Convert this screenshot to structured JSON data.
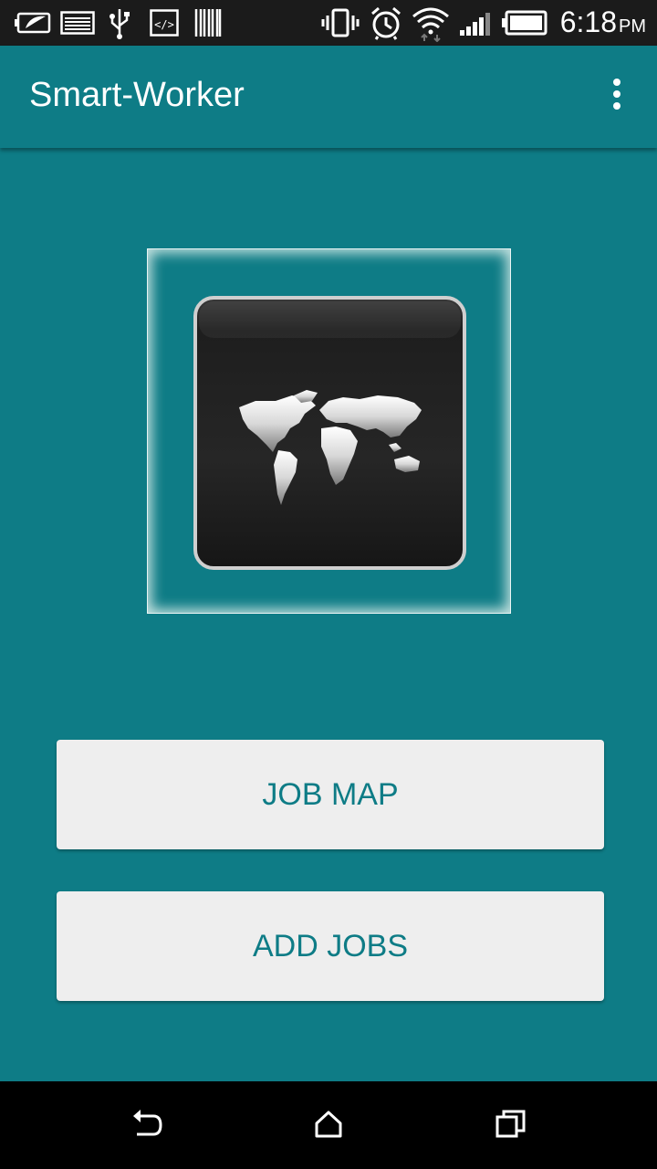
{
  "status_bar": {
    "icons": [
      "battery-saver-icon",
      "image-icon",
      "usb-icon",
      "code-icon",
      "barcode-icon",
      "vibrate-icon",
      "alarm-icon",
      "wifi-icon",
      "signal-icon",
      "battery-icon"
    ],
    "time": "6:18",
    "ampm": "PM"
  },
  "toolbar": {
    "title": "Smart-Worker",
    "menu_icon": "overflow-menu-icon"
  },
  "logo": {
    "icon": "world-map-icon"
  },
  "buttons": {
    "job_map": "JOB MAP",
    "add_jobs": "ADD JOBS"
  },
  "nav_bar": {
    "icons": [
      "back-icon",
      "home-icon",
      "recents-icon"
    ]
  },
  "colors": {
    "primary": "#0e7c86",
    "button_bg": "#eeeeee",
    "status_bar": "#1b1b1b",
    "nav_bar": "#000000"
  }
}
